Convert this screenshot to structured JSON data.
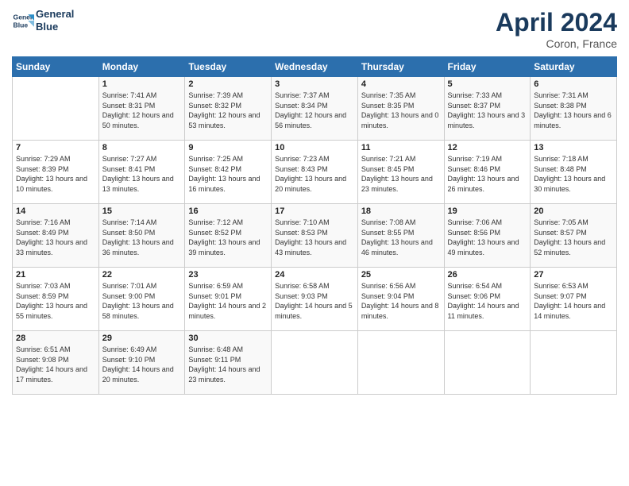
{
  "logo": {
    "line1": "General",
    "line2": "Blue"
  },
  "title": "April 2024",
  "location": "Coron, France",
  "header_days": [
    "Sunday",
    "Monday",
    "Tuesday",
    "Wednesday",
    "Thursday",
    "Friday",
    "Saturday"
  ],
  "weeks": [
    [
      {
        "day": "",
        "sunrise": "",
        "sunset": "",
        "daylight": ""
      },
      {
        "day": "1",
        "sunrise": "Sunrise: 7:41 AM",
        "sunset": "Sunset: 8:31 PM",
        "daylight": "Daylight: 12 hours and 50 minutes."
      },
      {
        "day": "2",
        "sunrise": "Sunrise: 7:39 AM",
        "sunset": "Sunset: 8:32 PM",
        "daylight": "Daylight: 12 hours and 53 minutes."
      },
      {
        "day": "3",
        "sunrise": "Sunrise: 7:37 AM",
        "sunset": "Sunset: 8:34 PM",
        "daylight": "Daylight: 12 hours and 56 minutes."
      },
      {
        "day": "4",
        "sunrise": "Sunrise: 7:35 AM",
        "sunset": "Sunset: 8:35 PM",
        "daylight": "Daylight: 13 hours and 0 minutes."
      },
      {
        "day": "5",
        "sunrise": "Sunrise: 7:33 AM",
        "sunset": "Sunset: 8:37 PM",
        "daylight": "Daylight: 13 hours and 3 minutes."
      },
      {
        "day": "6",
        "sunrise": "Sunrise: 7:31 AM",
        "sunset": "Sunset: 8:38 PM",
        "daylight": "Daylight: 13 hours and 6 minutes."
      }
    ],
    [
      {
        "day": "7",
        "sunrise": "Sunrise: 7:29 AM",
        "sunset": "Sunset: 8:39 PM",
        "daylight": "Daylight: 13 hours and 10 minutes."
      },
      {
        "day": "8",
        "sunrise": "Sunrise: 7:27 AM",
        "sunset": "Sunset: 8:41 PM",
        "daylight": "Daylight: 13 hours and 13 minutes."
      },
      {
        "day": "9",
        "sunrise": "Sunrise: 7:25 AM",
        "sunset": "Sunset: 8:42 PM",
        "daylight": "Daylight: 13 hours and 16 minutes."
      },
      {
        "day": "10",
        "sunrise": "Sunrise: 7:23 AM",
        "sunset": "Sunset: 8:43 PM",
        "daylight": "Daylight: 13 hours and 20 minutes."
      },
      {
        "day": "11",
        "sunrise": "Sunrise: 7:21 AM",
        "sunset": "Sunset: 8:45 PM",
        "daylight": "Daylight: 13 hours and 23 minutes."
      },
      {
        "day": "12",
        "sunrise": "Sunrise: 7:19 AM",
        "sunset": "Sunset: 8:46 PM",
        "daylight": "Daylight: 13 hours and 26 minutes."
      },
      {
        "day": "13",
        "sunrise": "Sunrise: 7:18 AM",
        "sunset": "Sunset: 8:48 PM",
        "daylight": "Daylight: 13 hours and 30 minutes."
      }
    ],
    [
      {
        "day": "14",
        "sunrise": "Sunrise: 7:16 AM",
        "sunset": "Sunset: 8:49 PM",
        "daylight": "Daylight: 13 hours and 33 minutes."
      },
      {
        "day": "15",
        "sunrise": "Sunrise: 7:14 AM",
        "sunset": "Sunset: 8:50 PM",
        "daylight": "Daylight: 13 hours and 36 minutes."
      },
      {
        "day": "16",
        "sunrise": "Sunrise: 7:12 AM",
        "sunset": "Sunset: 8:52 PM",
        "daylight": "Daylight: 13 hours and 39 minutes."
      },
      {
        "day": "17",
        "sunrise": "Sunrise: 7:10 AM",
        "sunset": "Sunset: 8:53 PM",
        "daylight": "Daylight: 13 hours and 43 minutes."
      },
      {
        "day": "18",
        "sunrise": "Sunrise: 7:08 AM",
        "sunset": "Sunset: 8:55 PM",
        "daylight": "Daylight: 13 hours and 46 minutes."
      },
      {
        "day": "19",
        "sunrise": "Sunrise: 7:06 AM",
        "sunset": "Sunset: 8:56 PM",
        "daylight": "Daylight: 13 hours and 49 minutes."
      },
      {
        "day": "20",
        "sunrise": "Sunrise: 7:05 AM",
        "sunset": "Sunset: 8:57 PM",
        "daylight": "Daylight: 13 hours and 52 minutes."
      }
    ],
    [
      {
        "day": "21",
        "sunrise": "Sunrise: 7:03 AM",
        "sunset": "Sunset: 8:59 PM",
        "daylight": "Daylight: 13 hours and 55 minutes."
      },
      {
        "day": "22",
        "sunrise": "Sunrise: 7:01 AM",
        "sunset": "Sunset: 9:00 PM",
        "daylight": "Daylight: 13 hours and 58 minutes."
      },
      {
        "day": "23",
        "sunrise": "Sunrise: 6:59 AM",
        "sunset": "Sunset: 9:01 PM",
        "daylight": "Daylight: 14 hours and 2 minutes."
      },
      {
        "day": "24",
        "sunrise": "Sunrise: 6:58 AM",
        "sunset": "Sunset: 9:03 PM",
        "daylight": "Daylight: 14 hours and 5 minutes."
      },
      {
        "day": "25",
        "sunrise": "Sunrise: 6:56 AM",
        "sunset": "Sunset: 9:04 PM",
        "daylight": "Daylight: 14 hours and 8 minutes."
      },
      {
        "day": "26",
        "sunrise": "Sunrise: 6:54 AM",
        "sunset": "Sunset: 9:06 PM",
        "daylight": "Daylight: 14 hours and 11 minutes."
      },
      {
        "day": "27",
        "sunrise": "Sunrise: 6:53 AM",
        "sunset": "Sunset: 9:07 PM",
        "daylight": "Daylight: 14 hours and 14 minutes."
      }
    ],
    [
      {
        "day": "28",
        "sunrise": "Sunrise: 6:51 AM",
        "sunset": "Sunset: 9:08 PM",
        "daylight": "Daylight: 14 hours and 17 minutes."
      },
      {
        "day": "29",
        "sunrise": "Sunrise: 6:49 AM",
        "sunset": "Sunset: 9:10 PM",
        "daylight": "Daylight: 14 hours and 20 minutes."
      },
      {
        "day": "30",
        "sunrise": "Sunrise: 6:48 AM",
        "sunset": "Sunset: 9:11 PM",
        "daylight": "Daylight: 14 hours and 23 minutes."
      },
      {
        "day": "",
        "sunrise": "",
        "sunset": "",
        "daylight": ""
      },
      {
        "day": "",
        "sunrise": "",
        "sunset": "",
        "daylight": ""
      },
      {
        "day": "",
        "sunrise": "",
        "sunset": "",
        "daylight": ""
      },
      {
        "day": "",
        "sunrise": "",
        "sunset": "",
        "daylight": ""
      }
    ]
  ]
}
